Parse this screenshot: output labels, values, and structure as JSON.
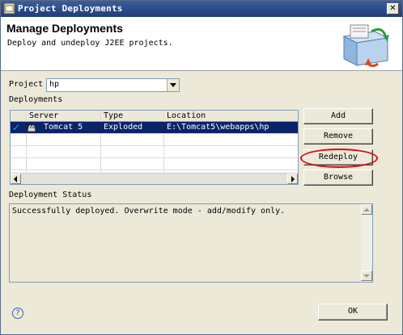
{
  "window": {
    "title": "Project Deployments",
    "close_glyph": "✕",
    "icon": "eclipse-window-icon"
  },
  "banner": {
    "heading": "Manage Deployments",
    "description": "Deploy and undeploy J2EE projects.",
    "image": "deployment-wizard-icon"
  },
  "project": {
    "label": "Project",
    "value": "hp"
  },
  "deployments": {
    "label": "Deployments",
    "columns": [
      "Server",
      "Type",
      "Location"
    ],
    "rows": [
      {
        "check": "✓",
        "server": "Tomcat 5",
        "type": "Exploded",
        "location": "E:\\Tomcat5\\webapps\\hp",
        "selected": true
      }
    ]
  },
  "buttons": {
    "add": "Add",
    "remove": "Remove",
    "redeploy": "Redeploy",
    "browse": "Browse",
    "ok": "OK"
  },
  "status": {
    "label": "Deployment Status",
    "text": "Successfully deployed. Overwrite mode - add/modify only."
  },
  "help_glyph": "?",
  "annotation": {
    "color": "#d60d16",
    "target": "redeploy-button"
  }
}
